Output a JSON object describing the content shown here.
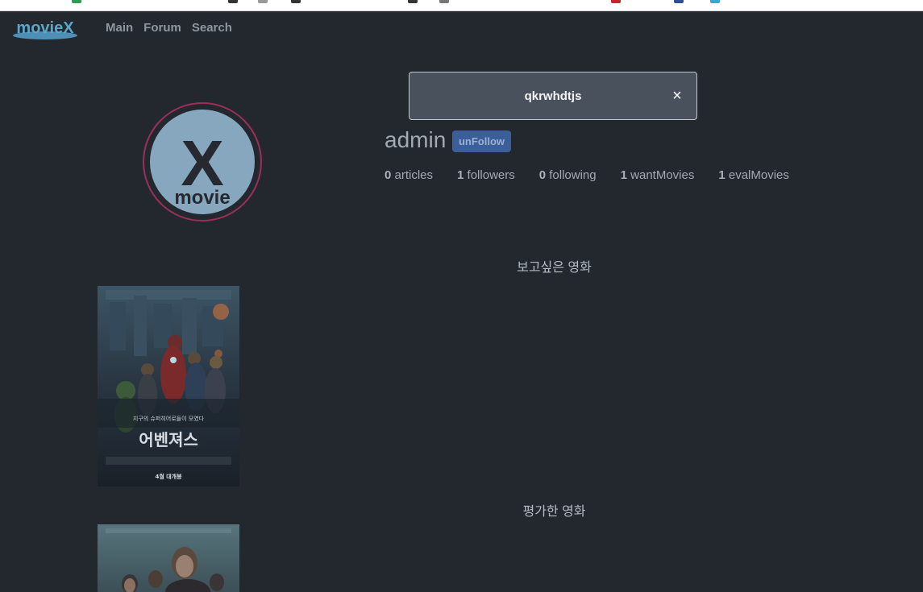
{
  "brand": {
    "logo_text": "movieX"
  },
  "nav": {
    "items": [
      {
        "label": "Main"
      },
      {
        "label": "Forum"
      },
      {
        "label": "Search"
      }
    ]
  },
  "profile": {
    "avatar_text": {
      "big": "X",
      "small": "movie"
    },
    "username": "admin",
    "follow_button": "unFollow",
    "stats": [
      {
        "count": "0",
        "label": "articles"
      },
      {
        "count": "1",
        "label": "followers"
      },
      {
        "count": "0",
        "label": "following"
      },
      {
        "count": "1",
        "label": "wantMovies"
      },
      {
        "count": "1",
        "label": "evalMovies"
      }
    ]
  },
  "sections": {
    "want": {
      "title": "보고싶은 영화",
      "poster_title": "어벤져스",
      "poster_tagline": "지구의 슈퍼히어로들이 모였다",
      "poster_date": "4월 대개봉"
    },
    "eval": {
      "title": "평가한 영화"
    }
  },
  "toast": {
    "message": "qkrwhdtjs",
    "close": "×"
  },
  "colors": {
    "background": "#23272e",
    "accent": "#3b5f9a",
    "avatar_ring": "#9c2f5a",
    "logo": "#4d8fb5"
  }
}
